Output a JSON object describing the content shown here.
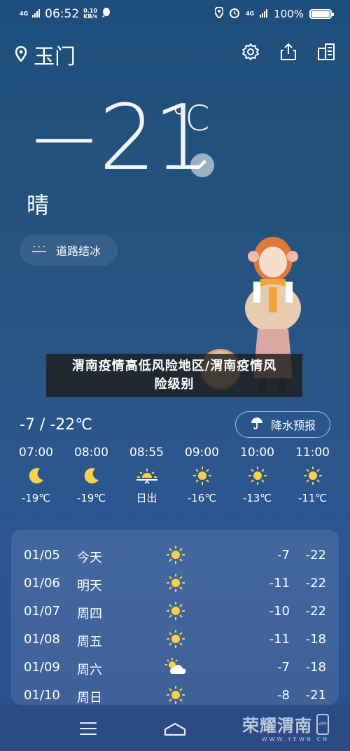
{
  "status_bar": {
    "network": "4G",
    "time": "06:52",
    "speed_value": "0.10",
    "speed_unit": "KB/s",
    "battery": "100%"
  },
  "header": {
    "city": "玉门",
    "icons": [
      "location-icon",
      "settings-icon",
      "share-icon",
      "city-list-icon"
    ]
  },
  "current": {
    "temperature": "−21",
    "unit": "℃",
    "condition": "晴",
    "alert_chip": "道路结冰"
  },
  "banner": {
    "line1": "渭南疫情高低风险地区/渭南疫情风",
    "line2": "险级别"
  },
  "range": {
    "text": "-7 / -22℃",
    "rain_button": "降水预报"
  },
  "hourly": [
    {
      "time": "07:00",
      "icon": "moon-icon",
      "value": "-19℃"
    },
    {
      "time": "08:00",
      "icon": "moon-icon",
      "value": "-19℃"
    },
    {
      "time": "08:55",
      "icon": "sunrise-icon",
      "value": "日出"
    },
    {
      "time": "09:00",
      "icon": "sun-icon",
      "value": "-16℃"
    },
    {
      "time": "10:00",
      "icon": "sun-icon",
      "value": "-13℃"
    },
    {
      "time": "11:00",
      "icon": "sun-icon",
      "value": "-11℃"
    }
  ],
  "daily": [
    {
      "date": "01/05",
      "weekday": "今天",
      "icon": "sun-icon",
      "high": "-7",
      "low": "-22"
    },
    {
      "date": "01/06",
      "weekday": "明天",
      "icon": "sun-icon",
      "high": "-11",
      "low": "-22"
    },
    {
      "date": "01/07",
      "weekday": "周四",
      "icon": "sun-icon",
      "high": "-10",
      "low": "-22"
    },
    {
      "date": "01/08",
      "weekday": "周五",
      "icon": "sun-icon",
      "high": "-11",
      "low": "-18"
    },
    {
      "date": "01/09",
      "weekday": "周六",
      "icon": "partly-cloudy-icon",
      "high": "-7",
      "low": "-18"
    },
    {
      "date": "01/10",
      "weekday": "周日",
      "icon": "sun-icon",
      "high": "-8",
      "low": "-21"
    }
  ],
  "watermark": {
    "title": "荣耀渭南",
    "url": "WWW.YEWN.CN",
    "app": "APP"
  },
  "colors": {
    "sun": "#f7d24a",
    "moon": "#f7d24a"
  }
}
